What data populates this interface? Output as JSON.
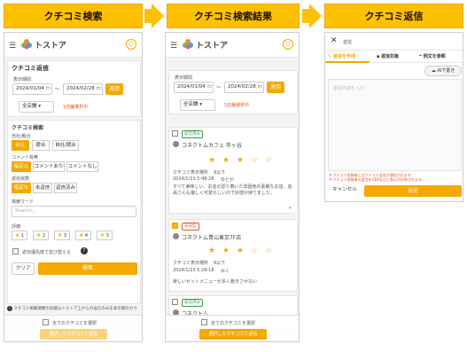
{
  "steps": [
    {
      "label": "クチコミ検索"
    },
    {
      "label": "クチコミ検索結果"
    },
    {
      "label": "クチコミ返信"
    }
  ],
  "app": {
    "brand": "トストア"
  },
  "colors": {
    "accent": "#f5a800",
    "banner": "#ffc000",
    "link": "#e05a2a",
    "replied": "#2e9e3e",
    "unreplied": "#e05a2a"
  },
  "search": {
    "page_title": "クチコミ返信",
    "period_label": "表示期間",
    "date_from": "2024/01/04",
    "tilde": "〜",
    "date_to": "2024/02/28",
    "apply_label": "適用",
    "store_select": "全店舗",
    "selected_link": "1店舗選択中",
    "section_title": "クチコミ検索",
    "owner_label": "自社/競合",
    "owner_options": [
      "自社",
      "競合",
      "自社/競合"
    ],
    "comment_label": "コメント有無",
    "comment_options": [
      "指定なし",
      "コメントあり",
      "コメントなし"
    ],
    "reply_label": "返信状態",
    "reply_options": [
      "指定なし",
      "未返信",
      "返信済み"
    ],
    "keyword_label": "検索ワード",
    "keyword_placeholder": "Search...",
    "rating_label": "評価",
    "rating_options": [
      "1",
      "2",
      "3",
      "4",
      "5"
    ],
    "sort_label": "返信優先度で並び替える",
    "clear_label": "クリア",
    "search_label": "検索",
    "note": "クチコミ掲載期間の投稿はトストア上からの返信のみを表示期のカウ",
    "select_all": "全てのクチコミを選択",
    "reply_selected": "選択したクチコミに返信"
  },
  "results": {
    "period_label": "表示期間",
    "date_from": "2024/01/04",
    "tilde": "〜",
    "date_to": "2024/02/28",
    "apply_label": "適用",
    "store_select": "全店舗",
    "selected_link": "1店舗選択中",
    "reviews": [
      {
        "status": "返信済み",
        "store": "コネクトムカフェ 市ヶ谷",
        "rating": 3,
        "source": "クチコミ表示場所",
        "source_value": "9以下",
        "date": "2024/1/23 5:48:26",
        "author": "ゆとか",
        "text": "すべて美味しい、お店の雰り着いた雰囲気の素朗なお店。店員さんも優しく可愛らしいので好感が持てました。"
      },
      {
        "status": "未返信",
        "store": "コネクトム青山東京7F店",
        "rating": 3,
        "source": "クチコミ表示場所",
        "source_value": "9以下",
        "date": "2024/1/23 5:29:18",
        "author": "みく",
        "text": "楽しいセットメニューが多く飽きさせない"
      },
      {
        "status": "返信済み",
        "store": "コネクトム",
        "rating": 0,
        "source": "",
        "source_value": "",
        "date": "",
        "author": "",
        "text": ""
      }
    ],
    "select_all": "全てのクチコミを選択",
    "reply_selected": "選択したクチコミに返信"
  },
  "reply": {
    "title": "返信",
    "tab_create": "返信を作成",
    "tab_target": "返信対象",
    "tab_examples": "例文を参照",
    "ai_draft": "AI下書き",
    "placeholder": "返信内容を入力",
    "warning_1": "※ クチコミ投稿者にはクチコミ返信が通知されます。",
    "warning_2": "※ クチコミ投稿者の返信をGBPなどに表示が反映されます。",
    "cancel": "キャンセル",
    "send": "送信"
  }
}
